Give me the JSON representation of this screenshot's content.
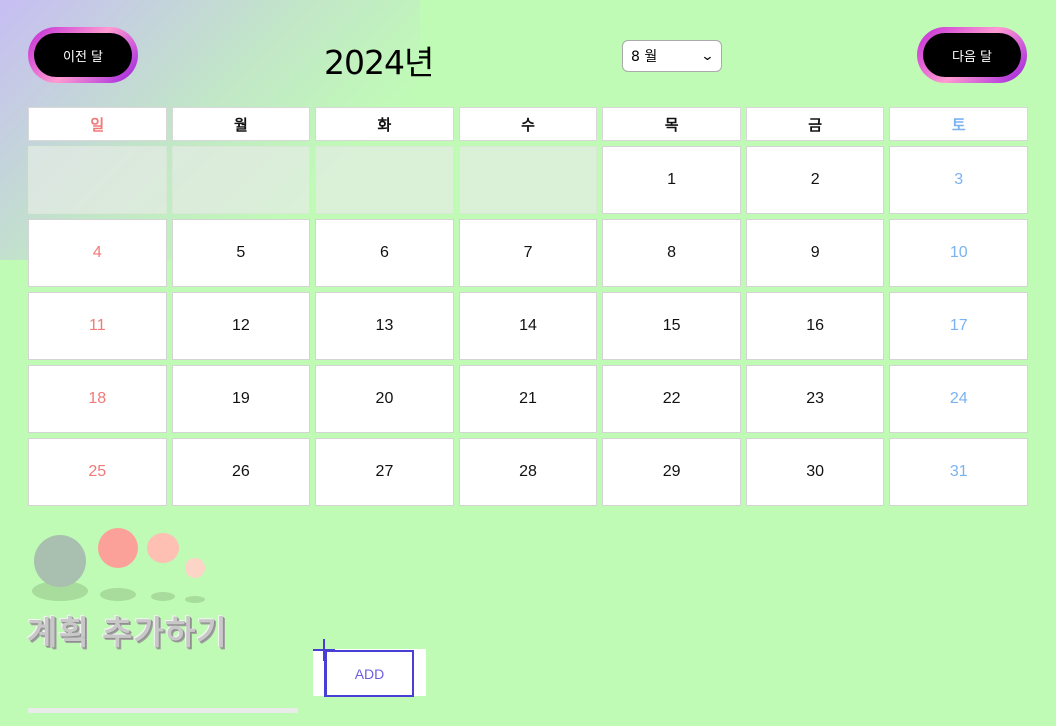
{
  "header": {
    "prev_label": "이전 달",
    "next_label": "다음 달",
    "year": "2024년",
    "month_selected": "8 월"
  },
  "weekdays": [
    "일",
    "월",
    "화",
    "수",
    "목",
    "금",
    "토"
  ],
  "calendar": {
    "weeks": [
      [
        "",
        "",
        "",
        "",
        "1",
        "2",
        "3"
      ],
      [
        "4",
        "5",
        "6",
        "7",
        "8",
        "9",
        "10"
      ],
      [
        "11",
        "12",
        "13",
        "14",
        "15",
        "16",
        "17"
      ],
      [
        "18",
        "19",
        "20",
        "21",
        "22",
        "23",
        "24"
      ],
      [
        "25",
        "26",
        "27",
        "28",
        "29",
        "30",
        "31"
      ]
    ]
  },
  "plan": {
    "title": "계획 추가하기",
    "add_label": "ADD"
  },
  "colors": {
    "background": "#c0fbb6",
    "sunday": "#f07a7a",
    "saturday": "#7ab3f0",
    "add_border": "#4a3fd4",
    "add_text": "#6b5fe0"
  },
  "icons": [
    "plus-icon",
    "chevron-down-icon"
  ]
}
